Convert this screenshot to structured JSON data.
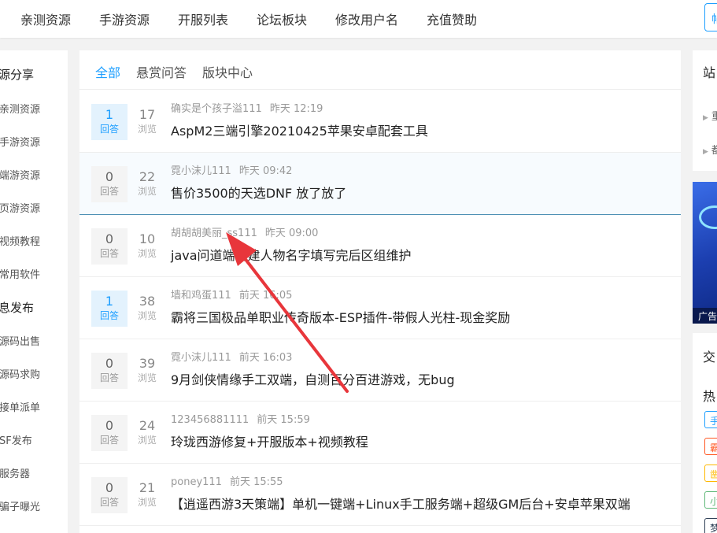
{
  "topnav": {
    "items": [
      "亲测资源",
      "手游资源",
      "开服列表",
      "论坛板块",
      "修改用户名",
      "充值赞助"
    ],
    "search_fragment": "帖"
  },
  "sidebar": {
    "sections": [
      {
        "title": "源分享",
        "items": [
          "亲测资源",
          "手游资源",
          "端游资源",
          "页游资源",
          "视频教程",
          "常用软件"
        ]
      },
      {
        "title": "息发布",
        "items": [
          "源码出售",
          "源码求购",
          "接单派单",
          "SF发布",
          "服务器",
          "骗子曝光"
        ]
      }
    ]
  },
  "tabs": [
    "全部",
    "悬赏问答",
    "版块中心"
  ],
  "labels": {
    "answers": "回答",
    "views": "浏览"
  },
  "threads": [
    {
      "answers": "1",
      "views": "17",
      "author": "确实是个孩子溢111",
      "time": "昨天 12:19",
      "title": "AspM2三端引擎20210425苹果安卓配套工具",
      "answered": true
    },
    {
      "answers": "0",
      "views": "22",
      "author": "霓小沫儿111",
      "time": "昨天 09:42",
      "title": "售价3500的天选DNF 放了放了",
      "answered": false
    },
    {
      "answers": "0",
      "views": "10",
      "author": "胡胡胡美丽_ss111",
      "time": "昨天 09:00",
      "title": "java问道端创建人物名字填写完后区组维护",
      "answered": false
    },
    {
      "answers": "1",
      "views": "38",
      "author": "墙和鸡蛋111",
      "time": "前天 16:05",
      "title": "霸将三国极品单职业传奇版本-ESP插件-带假人光柱-现金奖励",
      "answered": true
    },
    {
      "answers": "0",
      "views": "39",
      "author": "霓小沫儿111",
      "time": "前天 16:03",
      "title": "9月剑侠情缘手工双端，自测百分百进游戏，无bug",
      "answered": false
    },
    {
      "answers": "0",
      "views": "24",
      "author": "123456881111",
      "time": "前天 15:59",
      "title": "玲珑西游修复+开服版本+视频教程",
      "answered": false
    },
    {
      "answers": "0",
      "views": "21",
      "author": "poney111",
      "time": "前天 15:55",
      "title": "【逍遥西游3天策端】单机一键端+Linux手工服务端+超级GM后台+安卓苹果双端",
      "answered": false
    }
  ],
  "right": {
    "card1_title": "站",
    "card1_links": [
      "重",
      "都"
    ],
    "ad_label": "广告",
    "card2_title": "交",
    "hot_title": "热",
    "tags": [
      {
        "text": "手",
        "color": "#1e9fff"
      },
      {
        "text": "霸",
        "color": "#ff5722"
      },
      {
        "text": "凿",
        "color": "#ffb800"
      },
      {
        "text": "小",
        "color": "#5fb878"
      },
      {
        "text": "梦",
        "color": "#2f4056"
      }
    ]
  },
  "colors": {
    "accent": "#1e9fff",
    "annotation_arrow": "#e8363b"
  }
}
